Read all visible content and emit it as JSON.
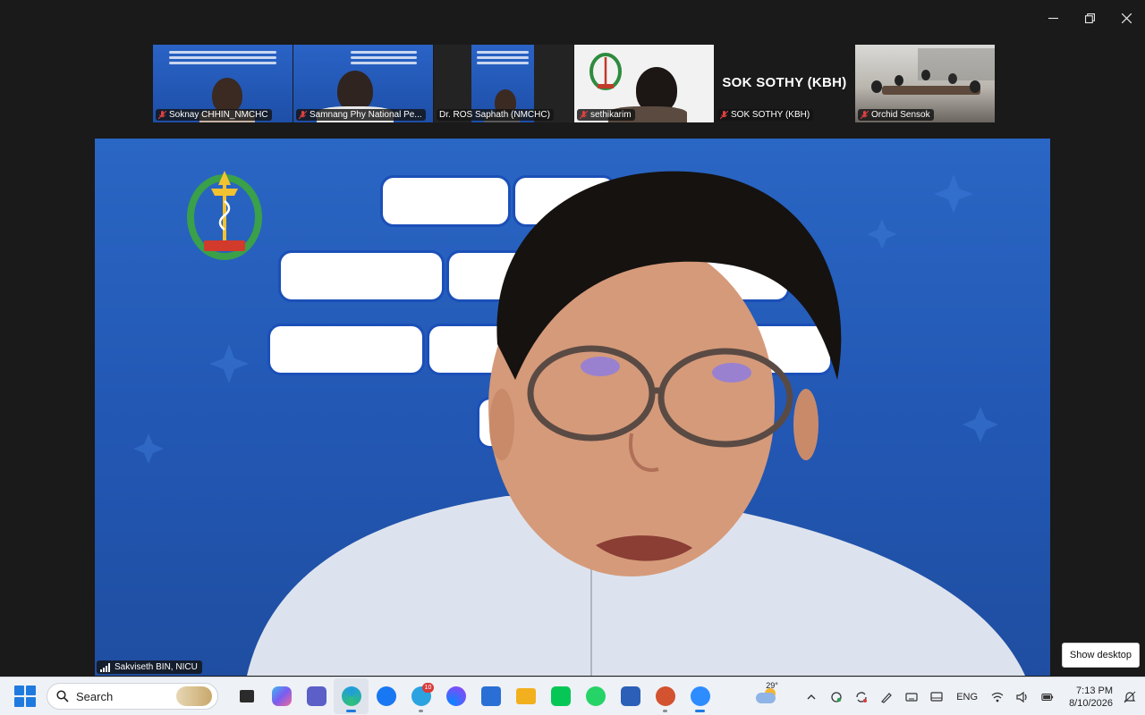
{
  "window": {
    "controls": [
      "minimize",
      "restore",
      "close"
    ]
  },
  "gallery": {
    "participants": [
      {
        "name": "Soknay CHHIN_NMCHC",
        "muted": true,
        "style": "blue"
      },
      {
        "name": "Samnang Phy National Pe...",
        "muted": true,
        "style": "blue"
      },
      {
        "name": "Dr. ROS Saphath (NMCHC)",
        "muted": false,
        "style": "dark"
      },
      {
        "name": "sethikarim",
        "muted": true,
        "style": "white"
      },
      {
        "name": "SOK SOTHY (KBH)",
        "muted": true,
        "style": "name",
        "display_name": "SOK SOTHY (KBH)"
      },
      {
        "name": "Orchid Sensok",
        "muted": true,
        "style": "room"
      }
    ]
  },
  "main": {
    "speaker_name": "Sakviseth BIN, NICU",
    "slide_bg": "#2257b3"
  },
  "tooltip": {
    "show_desktop": "Show desktop"
  },
  "taskbar": {
    "search_label": "Search",
    "apps": [
      {
        "name": "task-view",
        "color": "#2b2b2b"
      },
      {
        "name": "copilot",
        "color": "#7b5cf0"
      },
      {
        "name": "teams",
        "color": "#5b5fc7"
      },
      {
        "name": "edge",
        "color": "#1f9be0"
      },
      {
        "name": "facebook",
        "color": "#1877f2"
      },
      {
        "name": "telegram",
        "color": "#2aa3e0",
        "badge": "10"
      },
      {
        "name": "messenger",
        "color": "#0a84ff"
      },
      {
        "name": "store",
        "color": "#2a6fd6"
      },
      {
        "name": "file-explorer",
        "color": "#f2b01e"
      },
      {
        "name": "line",
        "color": "#06c755"
      },
      {
        "name": "whatsapp",
        "color": "#25d366"
      },
      {
        "name": "word",
        "color": "#2b5fb8"
      },
      {
        "name": "powerpoint",
        "color": "#d35230"
      },
      {
        "name": "zoom",
        "color": "#2d8cff"
      }
    ],
    "weather_temp": "29°",
    "language": "ENG",
    "time": "7:13 PM",
    "date": "8/10/2026"
  }
}
